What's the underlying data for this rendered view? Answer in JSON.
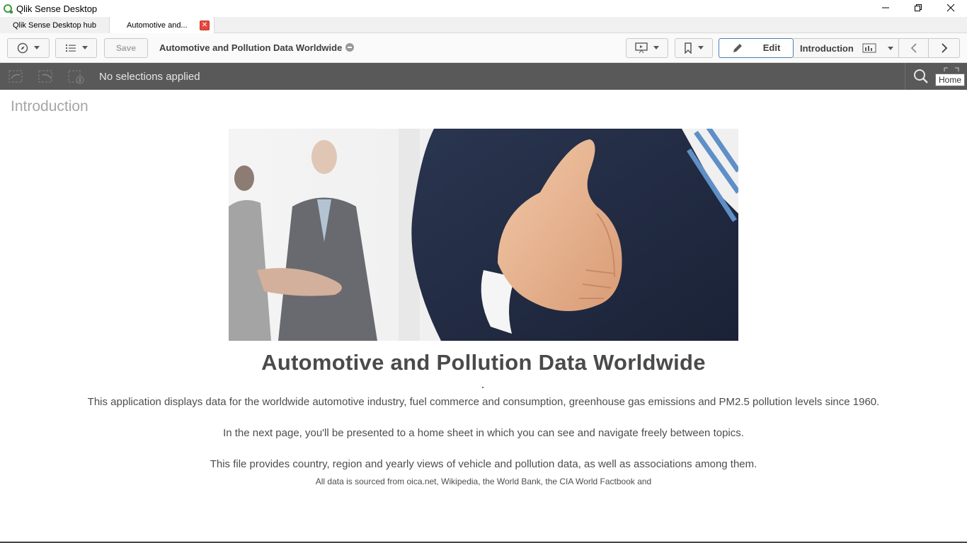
{
  "window": {
    "title": "Qlik Sense Desktop"
  },
  "tabs": [
    {
      "label": "Qlik Sense Desktop hub"
    },
    {
      "label": "Automotive and..."
    }
  ],
  "toolbar": {
    "save_label": "Save",
    "app_title": "Automotive and Pollution Data Worldwide",
    "edit_label": "Edit",
    "current_sheet": "Introduction"
  },
  "selections": {
    "status": "No selections applied",
    "home_tooltip": "Home"
  },
  "sheet": {
    "title": "Introduction",
    "heading": "Automotive and Pollution Data Worldwide",
    "paragraphs": [
      "This application displays data for the worldwide automotive industry, fuel commerce and consumption, greenhouse gas emissions and PM2.5 pollution levels since 1960.",
      "In the next page, you'll be presented to a home sheet in which you can see and navigate freely between topics.",
      "This file provides country, region and yearly views of vehicle and pollution data, as well as associations among them."
    ],
    "source_note": "All data is sourced from oica.net, Wikipedia, the World Bank, the CIA World Factbook and"
  }
}
